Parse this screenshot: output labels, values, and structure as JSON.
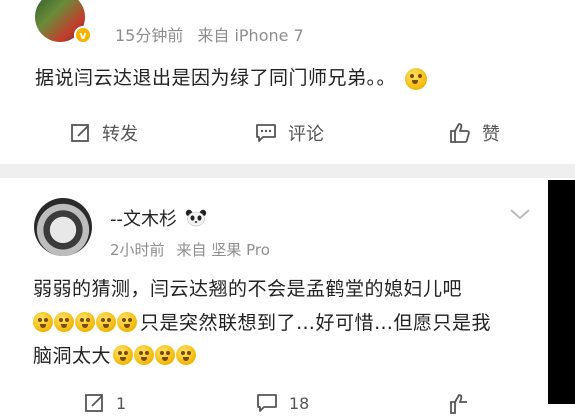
{
  "post1": {
    "meta_time": "15分钟前",
    "meta_source": "来自 iPhone 7",
    "text": "据说闫云达退出是因为绿了同门师兄弟。。",
    "actions": {
      "repost_label": "转发",
      "comment_label": "评论",
      "like_label": "赞"
    }
  },
  "post2": {
    "username": "--文木杉",
    "meta_time": "2小时前",
    "meta_source": "来自 坚果 Pro",
    "line1": "弱弱的猜测，闫云达翘的不会是孟鹤堂的媳妇儿吧",
    "line2_text": "只是突然联想到了…好可惜…但愿只是我",
    "line3_text": "脑洞太大",
    "actions": {
      "repost_count": "1",
      "comment_count": "18"
    }
  }
}
